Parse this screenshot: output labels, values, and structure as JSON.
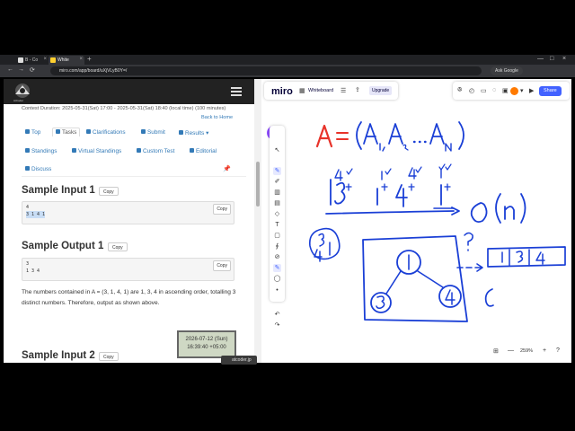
{
  "browser": {
    "tabs": [
      {
        "label": "B - Co",
        "close": "×"
      },
      {
        "label": "White",
        "close": "×"
      }
    ],
    "new_tab": "+",
    "url": "miro.com/app/board/uXjVLyB0Y=/",
    "ask_google": "Ask Google",
    "window_buttons": [
      "—",
      "□",
      "×"
    ],
    "nav": [
      "←",
      "→",
      "⟳"
    ]
  },
  "atcoder": {
    "logo_text": "AtCoder",
    "contest_duration": "Contest Duration: 2025-05-31(Sat) 17:00 - 2025-05-31(Sat) 18:40 (local time) (100 minutes)",
    "back_home": "Back to Home",
    "nav_row1": [
      "Top",
      "Tasks",
      "Clarifications",
      "Submit",
      "Results ▾"
    ],
    "nav_row2": [
      "Standings",
      "Virtual Standings",
      "Custom Test",
      "Editorial"
    ],
    "nav_row3": [
      "Discuss"
    ],
    "pin": "📌",
    "sample_input_1": {
      "title": "Sample Input 1",
      "copy": "Copy",
      "content": [
        "4",
        "3 1 4 1"
      ]
    },
    "sample_output_1": {
      "title": "Sample Output 1",
      "copy": "Copy",
      "content": [
        "3",
        "1 3 4"
      ]
    },
    "explanation": "The numbers contained in A = (3, 1, 4, 1) are 1, 3, 4 in ascending order, totalling 3 distinct numbers. Therefore, output as shown above.",
    "sample_input_2": {
      "title": "Sample Input 2",
      "copy": "Copy"
    }
  },
  "clock": {
    "date": "2026-07-12 (Sun)",
    "time": "16:39:40 +05:00"
  },
  "miro": {
    "logo": "miro",
    "board_name": "Whiteboard",
    "upgrade": "Upgrade",
    "share": "Share",
    "zoom": "259%",
    "ai": "✦",
    "zoom_minus": "—",
    "zoom_plus": "+",
    "help": "?"
  },
  "taskbar": {
    "item": "atcoder.jp"
  },
  "drawing": {
    "accent_red": "#e8332a",
    "ink_blue": "#1a3fd6",
    "formula": "A = (A1, A2 ... AN)",
    "sequence": "1 3 1 4 1",
    "complexity": "O(n)",
    "result": "1 | 3 | 4",
    "nodes": [
      "1",
      "3",
      "4"
    ],
    "note": "3 4 1",
    "question": "?"
  }
}
